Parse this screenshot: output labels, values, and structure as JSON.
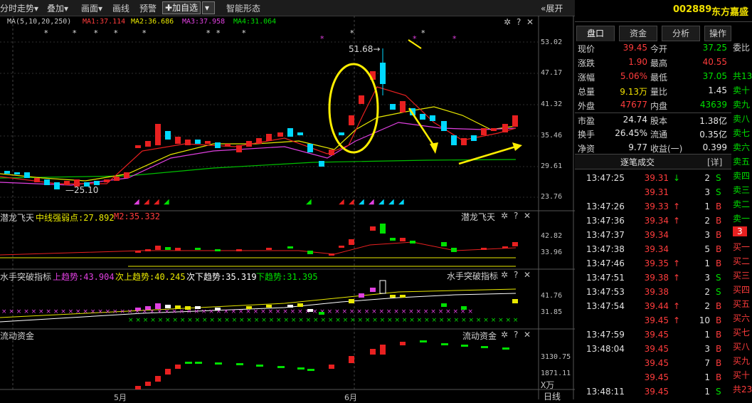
{
  "toolbar": {
    "items": [
      "分时走势",
      "叠加",
      "画面",
      "画线",
      "预警"
    ],
    "add_watch": "加自选",
    "smart_form": "智能形态",
    "expand": "展开"
  },
  "main_panel": {
    "ma_label": "MA(5,10,20,250)",
    "ma1": "MA1:37.114",
    "ma2": "MA2:36.686",
    "ma3": "MA3:37.958",
    "ma4": "MA4:31.064",
    "y_ticks": [
      "53.02",
      "47.17",
      "41.32",
      "35.46",
      "29.61",
      "23.76"
    ],
    "peak_label": "51.68",
    "low_label": "25.10"
  },
  "panel2": {
    "title": "潜龙飞天",
    "item1": "中线强弱点:27.892",
    "item2": "M2:35.332",
    "y_ticks": [
      "42.82",
      "33.96"
    ]
  },
  "panel3": {
    "title": "水手突破指标",
    "item1": "上趋势:43.904",
    "item2": "次上趋势:40.245",
    "item3": "次下趋势:35.319",
    "item4": "下趋势:31.395",
    "y_ticks": [
      "41.76",
      "31.85"
    ]
  },
  "panel4": {
    "title": "流动资金",
    "y_ticks": [
      "3130.75",
      "1871.11"
    ],
    "unit": "X万"
  },
  "x_axis": {
    "labels": [
      "5月",
      "6月"
    ],
    "mode": "日线"
  },
  "stock": {
    "code": "002889",
    "name": "东方嘉盛"
  },
  "tabs": [
    "盘口",
    "资金",
    "分析",
    "操作"
  ],
  "quote": {
    "rows": [
      {
        "l1": "现价",
        "v1": "39.45",
        "c1": "red",
        "l2": "今开",
        "v2": "37.25",
        "c2": "green"
      },
      {
        "l1": "涨跌",
        "v1": "1.90",
        "c1": "red",
        "l2": "最高",
        "v2": "40.55",
        "c2": "red"
      },
      {
        "l1": "涨幅",
        "v1": "5.06%",
        "c1": "red",
        "l2": "最低",
        "v2": "37.05",
        "c2": "green"
      },
      {
        "l1": "总量",
        "v1": "9.13万",
        "c1": "yellow",
        "l2": "量比",
        "v2": "1.45",
        "c2": "white"
      },
      {
        "l1": "外盘",
        "v1": "47677",
        "c1": "red",
        "l2": "内盘",
        "v2": "43639",
        "c2": "green"
      },
      {
        "l1": "市盈",
        "v1": "24.74",
        "c1": "white",
        "l2": "股本",
        "v2": "1.38亿",
        "c2": "white"
      },
      {
        "l1": "换手",
        "v1": "26.45%",
        "c1": "white",
        "l2": "流通",
        "v2": "0.35亿",
        "c2": "white"
      },
      {
        "l1": "净资",
        "v1": "9.77",
        "c1": "white",
        "l2": "收益(一)",
        "v2": "0.399",
        "c2": "white"
      }
    ]
  },
  "trades_header": "逐笔成交",
  "trades_detail": "[详]",
  "trades": [
    {
      "time": "13:47:25",
      "price": "39.31",
      "arrow": "↓",
      "vol": "2",
      "side": "S"
    },
    {
      "time": "",
      "price": "39.31",
      "arrow": "",
      "vol": "3",
      "side": "S"
    },
    {
      "time": "13:47:26",
      "price": "39.33",
      "arrow": "↑",
      "vol": "1",
      "side": "B"
    },
    {
      "time": "13:47:36",
      "price": "39.34",
      "arrow": "↑",
      "vol": "2",
      "side": "B"
    },
    {
      "time": "13:47:37",
      "price": "39.34",
      "arrow": "",
      "vol": "3",
      "side": "B"
    },
    {
      "time": "13:47:38",
      "price": "39.34",
      "arrow": "",
      "vol": "5",
      "side": "B"
    },
    {
      "time": "13:47:46",
      "price": "39.35",
      "arrow": "↑",
      "vol": "1",
      "side": "B"
    },
    {
      "time": "13:47:51",
      "price": "39.38",
      "arrow": "↑",
      "vol": "3",
      "side": "S"
    },
    {
      "time": "13:47:53",
      "price": "39.38",
      "arrow": "",
      "vol": "2",
      "side": "S"
    },
    {
      "time": "13:47:54",
      "price": "39.44",
      "arrow": "↑",
      "vol": "2",
      "side": "B"
    },
    {
      "time": "",
      "price": "39.45",
      "arrow": "↑",
      "vol": "10",
      "side": "B"
    },
    {
      "time": "13:47:59",
      "price": "39.45",
      "arrow": "",
      "vol": "1",
      "side": "B"
    },
    {
      "time": "13:48:04",
      "price": "39.45",
      "arrow": "",
      "vol": "3",
      "side": "B"
    },
    {
      "time": "",
      "price": "39.45",
      "arrow": "",
      "vol": "7",
      "side": "B"
    },
    {
      "time": "",
      "price": "39.45",
      "arrow": "",
      "vol": "1",
      "side": "B"
    },
    {
      "time": "13:48:11",
      "price": "39.45",
      "arrow": "",
      "vol": "1",
      "side": "S"
    }
  ],
  "orderbook_side": [
    "委比",
    "共13",
    "卖十",
    "卖九",
    "卖八",
    "卖七",
    "卖六",
    "卖五",
    "卖四",
    "卖三",
    "卖二",
    "卖一",
    "3",
    "买一",
    "买二",
    "买三",
    "买四",
    "买五",
    "买六",
    "买七",
    "买八",
    "买九",
    "买十",
    "共23"
  ],
  "chart_data": {
    "type": "candlestick",
    "y_range": [
      23.76,
      53.02
    ],
    "peak": 51.68,
    "low": 25.1,
    "ma_values": {
      "MA1": 37.114,
      "MA2": 36.686,
      "MA3": 37.958,
      "MA4": 31.064
    }
  }
}
